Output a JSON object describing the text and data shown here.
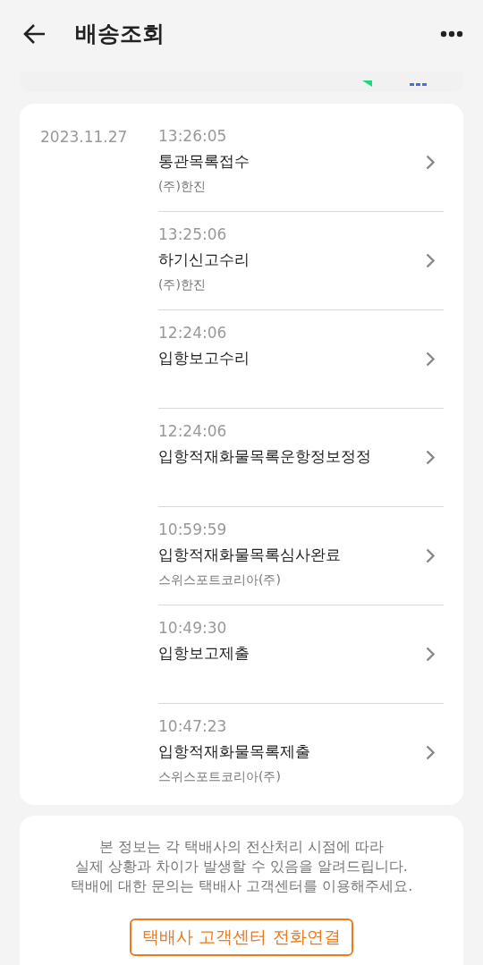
{
  "header": {
    "title": "배송조회"
  },
  "tracking": {
    "date": "2023.11.27",
    "events": [
      {
        "time": "13:26:05",
        "status": "통관목록접수",
        "company": "(주)한진"
      },
      {
        "time": "13:25:06",
        "status": "하기신고수리",
        "company": "(주)한진"
      },
      {
        "time": "12:24:06",
        "status": "입항보고수리"
      },
      {
        "time": "12:24:06",
        "status": "입항적재화물목록운항정보정정"
      },
      {
        "time": "10:59:59",
        "status": "입항적재화물목록심사완료",
        "company": "스위스포트코리아(주)"
      },
      {
        "time": "10:49:30",
        "status": "입항보고제출"
      },
      {
        "time": "10:47:23",
        "status": "입항적재화물목록제출",
        "company": "스위스포트코리아(주)"
      }
    ]
  },
  "notice": {
    "lines": [
      "본 정보는 각 택배사의 전산처리 시점에 따라",
      "실제 상황과 차이가 발생할 수 있음을 알려드립니다.",
      "택배에 대한 문의는 택배사 고객센터를 이용해주세요."
    ],
    "button": "택배사 고객센터 전화연결"
  }
}
